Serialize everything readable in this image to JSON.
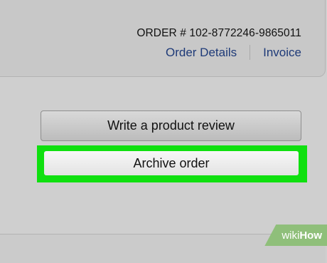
{
  "order": {
    "number_label": "ORDER # 102-8772246-9865011"
  },
  "links": {
    "order_details": "Order Details",
    "invoice": "Invoice"
  },
  "actions": {
    "review_label": "Write a product review",
    "archive_label": "Archive order"
  },
  "colors": {
    "background": "#cfcfcf",
    "link": "#1e3a78",
    "highlight": "#0fe00f",
    "watermark": "#8fbf7a"
  },
  "watermark": {
    "wiki": "wiki",
    "how": "How"
  }
}
